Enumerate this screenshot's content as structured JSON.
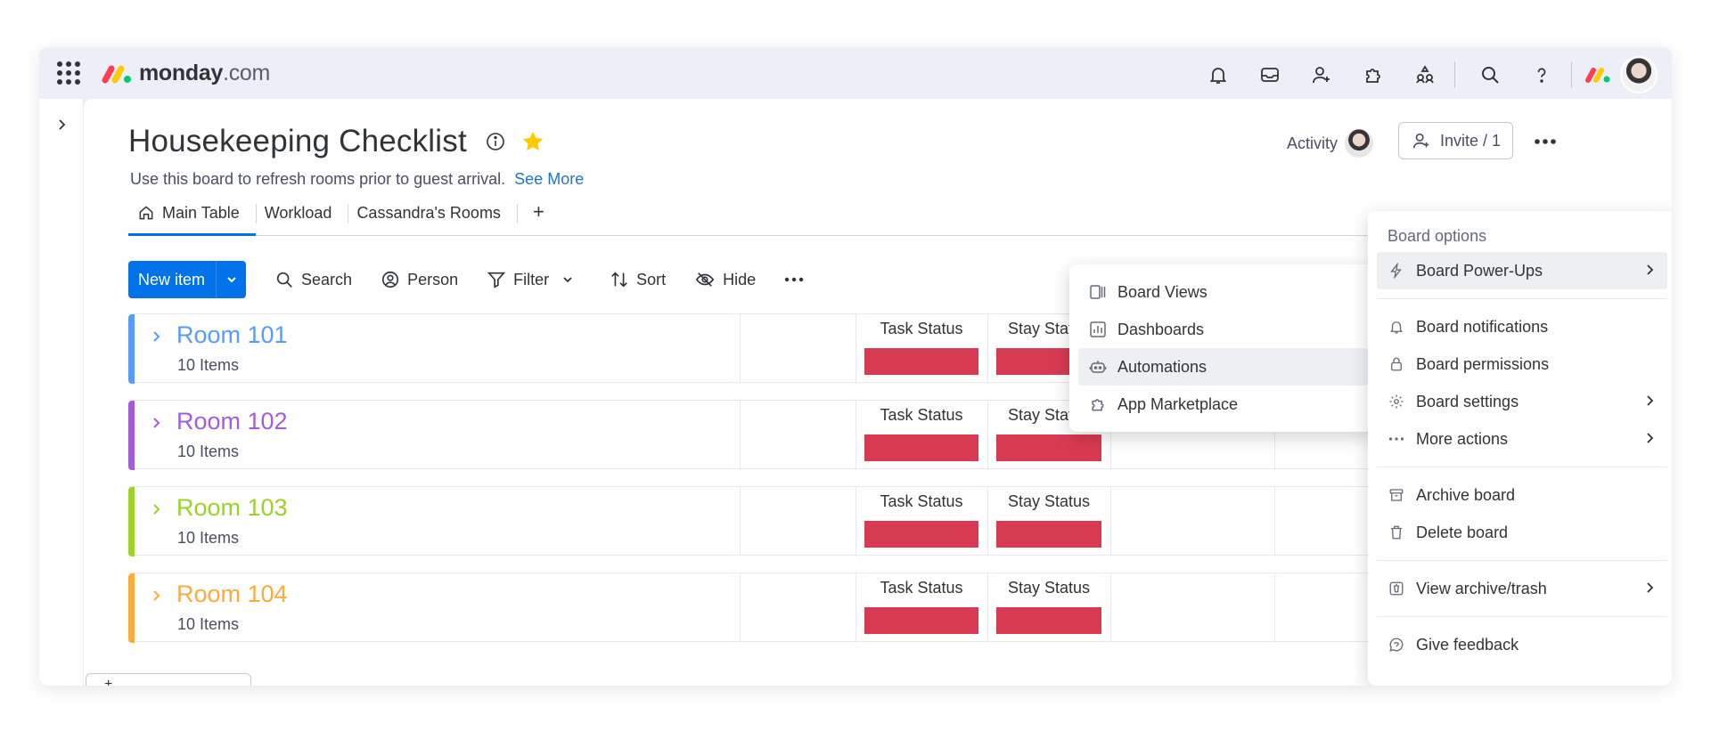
{
  "app": {
    "brand": "monday",
    "brand_suffix": ".com",
    "brand_colors": [
      "#ff3d57",
      "#ffcb00",
      "#00ca72"
    ]
  },
  "topbar": {
    "icons": [
      "apps-grid-icon",
      "notifications-bell-icon",
      "inbox-icon",
      "invite-members-icon",
      "marketplace-puzzle-icon",
      "workspace-people-icon",
      "search-icon",
      "help-icon",
      "monday-switcher-icon",
      "user-avatar"
    ]
  },
  "board": {
    "title": "Housekeeping Checklist",
    "description": "Use this board to refresh rooms prior to guest arrival.",
    "see_more": "See More",
    "activity_label": "Activity",
    "invite_label": "Invite / 1",
    "tabs": [
      {
        "label": "Main Table",
        "active": true,
        "icon": "home-icon"
      },
      {
        "label": "Workload",
        "active": false
      },
      {
        "label": "Cassandra's Rooms",
        "active": false
      }
    ],
    "add_view": "+"
  },
  "toolbar": {
    "new_item": "New item",
    "search": "Search",
    "person": "Person",
    "filter": "Filter",
    "sort": "Sort",
    "hide": "Hide"
  },
  "groups": [
    {
      "name": "Room 101",
      "count": "10 Items",
      "color": "#579bfc",
      "task_status": "Task Status",
      "stay_status": "Stay Status"
    },
    {
      "name": "Room 102",
      "count": "10 Items",
      "color": "#a25ddc",
      "task_status": "Task Status",
      "stay_status": "Stay Status"
    },
    {
      "name": "Room 103",
      "count": "10 Items",
      "color": "#9cd326",
      "task_status": "Task Status",
      "stay_status": "Stay Status"
    },
    {
      "name": "Room 104",
      "count": "10 Items",
      "color": "#fdab3d",
      "task_status": "Task Status",
      "stay_status": "Stay Status"
    }
  ],
  "status_color": "#d83a52",
  "submenu": {
    "items": [
      {
        "label": "Board Views",
        "icon": "board-views-icon"
      },
      {
        "label": "Dashboards",
        "icon": "dashboards-icon"
      },
      {
        "label": "Automations",
        "icon": "automations-robot-icon",
        "hover": true
      },
      {
        "label": "App Marketplace",
        "icon": "app-marketplace-icon"
      }
    ]
  },
  "board_menu": {
    "heading": "Board options",
    "items": [
      {
        "label": "Board Power-Ups",
        "icon": "lightning-icon",
        "submenu": true,
        "hover": true
      },
      {
        "label": "Board notifications",
        "icon": "bell-icon"
      },
      {
        "label": "Board permissions",
        "icon": "lock-icon"
      },
      {
        "label": "Board settings",
        "icon": "gear-icon",
        "submenu": true
      },
      {
        "label": "More actions",
        "icon": "more-dots-icon",
        "submenu": true
      },
      {
        "label": "Archive board",
        "icon": "archive-icon"
      },
      {
        "label": "Delete board",
        "icon": "trash-icon"
      },
      {
        "label": "View archive/trash",
        "icon": "archive-trash-icon",
        "submenu": true
      },
      {
        "label": "Give feedback",
        "icon": "feedback-icon"
      }
    ]
  }
}
